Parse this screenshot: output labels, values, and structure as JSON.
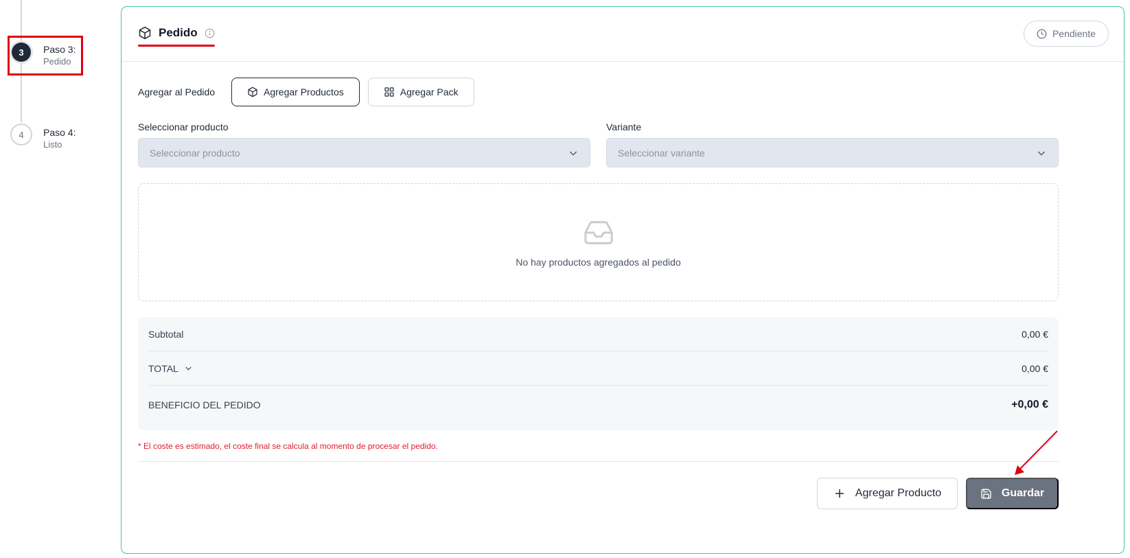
{
  "stepper": {
    "steps": [
      {
        "number": "3",
        "title": "Paso 3:",
        "subtitle": "Pedido",
        "state": "active"
      },
      {
        "number": "4",
        "title": "Paso 4:",
        "subtitle": "Listo",
        "state": "pending"
      }
    ]
  },
  "header": {
    "tab_label": "Pedido",
    "status_label": "Pendiente"
  },
  "add_section": {
    "label": "Agregar al Pedido",
    "add_products_label": "Agregar Productos",
    "add_pack_label": "Agregar Pack"
  },
  "selectors": {
    "product_label": "Seleccionar producto",
    "product_placeholder": "Seleccionar producto",
    "variant_label": "Variante",
    "variant_placeholder": "Seleccionar variante"
  },
  "empty_state": {
    "message": "No hay productos agregados al pedido"
  },
  "totals": {
    "subtotal_label": "Subtotal",
    "subtotal_value": "0,00 €",
    "total_label": "TOTAL",
    "total_value": "0,00 €",
    "profit_label": "BENEFICIO DEL PEDIDO",
    "profit_value": "+0,00 €"
  },
  "disclaimer": "* El coste es estimado, el coste final se calcula al momento de procesar el pedido.",
  "footer": {
    "add_product_label": "Agregar Producto",
    "save_label": "Guardar"
  },
  "colors": {
    "card_border": "#45c59a",
    "highlight": "#e0000f",
    "disclaimer": "#e11d2e",
    "save_button": "#6b7280"
  },
  "icons": {
    "tab": "box-icon",
    "info": "info-icon",
    "status": "clock-icon",
    "add_products": "box-icon",
    "add_pack": "grid-icon",
    "select_chevron": "chevron-down-icon",
    "empty": "inbox-icon",
    "total_toggle": "chevron-down-icon",
    "add_product": "plus-icon",
    "save": "save-icon"
  }
}
